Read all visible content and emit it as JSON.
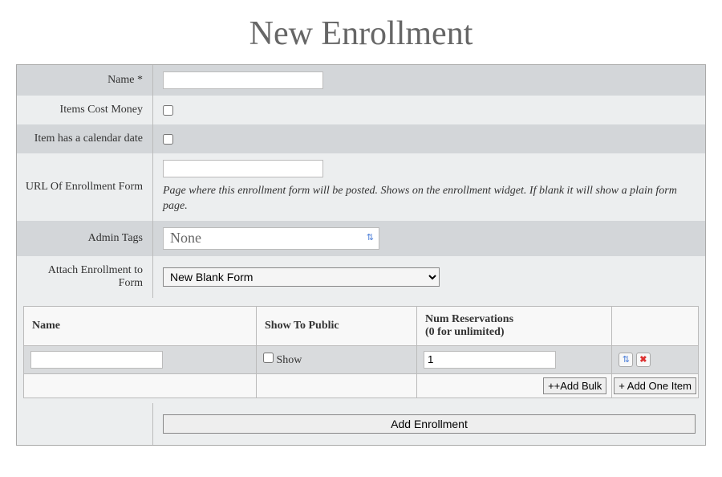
{
  "title": "New Enrollment",
  "fields": {
    "name": {
      "label": "Name *",
      "value": ""
    },
    "cost_money": {
      "label": "Items Cost Money",
      "checked": false
    },
    "calendar_date": {
      "label": "Item has a calendar date",
      "checked": false
    },
    "url": {
      "label": "URL Of Enrollment Form",
      "value": "",
      "help": "Page where this enrollment form will be posted. Shows on the enrollment widget. If blank it will show a plain form page."
    },
    "admin_tags": {
      "label": "Admin Tags",
      "selected": "None"
    },
    "attach_form": {
      "label": "Attach Enrollment to Form",
      "selected": "New Blank Form"
    }
  },
  "items_table": {
    "headers": {
      "name": "Name",
      "show": "Show To Public",
      "reservations": "Num Reservations\n(0 for unlimited)",
      "actions": ""
    },
    "row": {
      "name": "",
      "show_label": "Show",
      "show_checked": false,
      "reservations": "1"
    },
    "buttons": {
      "add_bulk": "++Add Bulk",
      "add_one": "+ Add One Item"
    }
  },
  "submit_label": "Add Enrollment"
}
